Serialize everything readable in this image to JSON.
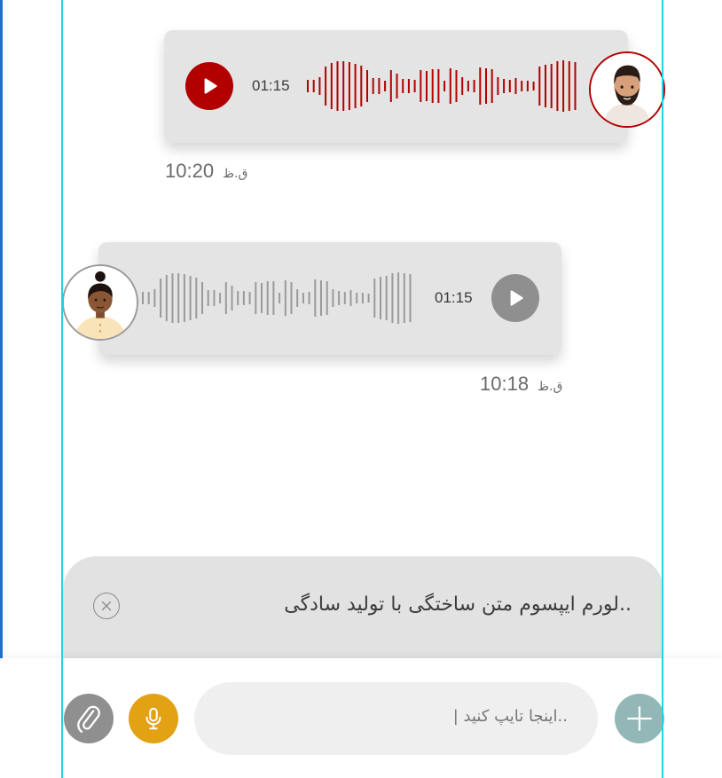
{
  "messages": {
    "sent": {
      "duration": "01:15",
      "time": "10:20",
      "ampm": "ق.ظ",
      "accent": "#b20000"
    },
    "received": {
      "duration": "01:15",
      "time": "10:18",
      "ampm": "ق.ظ",
      "accent": "#9a9a9a"
    }
  },
  "reply_preview": {
    "text": "..لورم ایپسوم متن ساختگی با تولید سادگی",
    "close_icon": "close-circle-icon"
  },
  "composer": {
    "placeholder": "..اینجا تایپ کنید  |",
    "attach_icon": "paperclip-icon",
    "mic_icon": "microphone-icon",
    "add_icon": "plus-icon",
    "colors": {
      "attach": "#8f8f8f",
      "mic": "#e3a114",
      "add": "#93b7b6"
    }
  }
}
